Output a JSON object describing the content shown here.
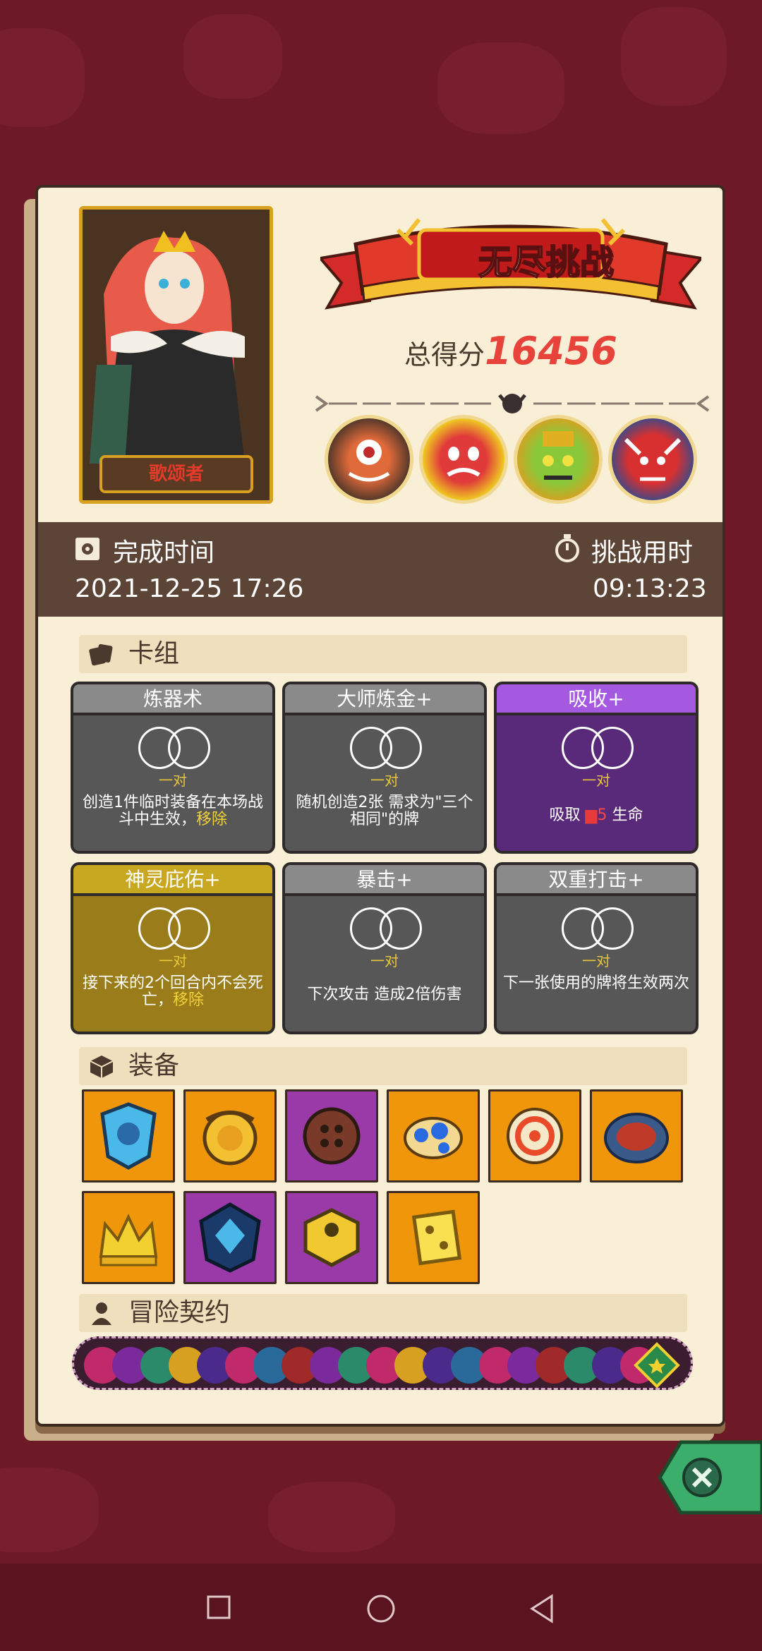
{
  "header": {
    "banner_title": "无尽挑战",
    "score_label": "总得分",
    "score_value": "16456"
  },
  "hero": {
    "name": "歌颂者"
  },
  "time": {
    "complete_label": "完成时间",
    "complete_value": "2021-12-25 17:26",
    "duration_label": "挑战用时",
    "duration_value": "09:13:23"
  },
  "deck": {
    "title": "卡组",
    "cards": [
      {
        "name": "炼器术",
        "pair": "一对",
        "desc": "创造1件临时装备在本场战斗中生效，",
        "remove": "移除",
        "style": "gray"
      },
      {
        "name": "大师炼金+",
        "pair": "一对",
        "desc": "随机创造2张 需求为\"三个相同\"的牌",
        "remove": "",
        "style": "gray"
      },
      {
        "name": "吸收+",
        "pair": "一对",
        "desc": "吸取",
        "desc_value": "5",
        "desc_suffix": "生命",
        "remove": "",
        "style": "purple"
      },
      {
        "name": "神灵庇佑+",
        "pair": "一对",
        "desc": "接下来的2个回合内不会死亡，",
        "remove": "移除",
        "style": "gold"
      },
      {
        "name": "暴击+",
        "pair": "一对",
        "desc": "下次攻击 造成2倍伤害",
        "remove": "",
        "style": "gray"
      },
      {
        "name": "双重打击+",
        "pair": "一对",
        "desc": "下一张使用的牌将生效两次",
        "remove": "",
        "style": "gray"
      }
    ]
  },
  "equipment": {
    "title": "装备",
    "items": [
      {
        "icon": "blue-shield-icon",
        "color": "orange"
      },
      {
        "icon": "lion-ring-icon",
        "color": "orange"
      },
      {
        "icon": "button-icon",
        "color": "purple"
      },
      {
        "icon": "blue-dots-icon",
        "color": "orange"
      },
      {
        "icon": "target-ring-icon",
        "color": "orange"
      },
      {
        "icon": "meat-plate-icon",
        "color": "orange"
      },
      {
        "icon": "crown-icon",
        "color": "orange"
      },
      {
        "icon": "dark-shield-icon",
        "color": "purple"
      },
      {
        "icon": "gold-cube-icon",
        "color": "purple"
      },
      {
        "icon": "dice-icon",
        "color": "orange"
      }
    ]
  },
  "contract": {
    "title": "冒险契约"
  },
  "colors": {
    "background": "#6e1a26",
    "panel": "#f8efd6",
    "score": "#e8433a",
    "orange_slot": "#f0960a",
    "purple_slot": "#9a3aa8"
  }
}
